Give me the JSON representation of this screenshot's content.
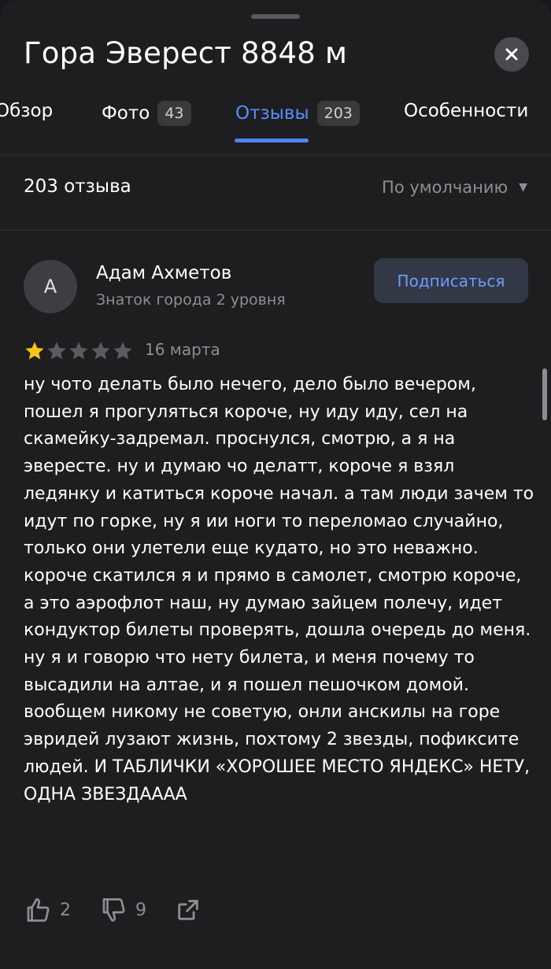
{
  "header": {
    "title": "Гора Эверест 8848 м"
  },
  "tabs": [
    {
      "label": "Обзор",
      "badge": null
    },
    {
      "label": "Фото",
      "badge": "43"
    },
    {
      "label": "Отзывы",
      "badge": "203"
    },
    {
      "label": "Особенности",
      "badge": null
    }
  ],
  "reviews_header": {
    "count": "203 отзыва",
    "sort": "По умолчанию"
  },
  "review": {
    "avatar_letter": "А",
    "author": "Адам Ахметов",
    "level": "Знаток города 2 уровня",
    "subscribe": "Подписаться",
    "rating": 1,
    "rating_max": 5,
    "date": "16 марта",
    "text": "ну чото делать было нечего, дело было вечером, пошел я прогуляться короче, ну иду иду, сел на скамейку-задремал. проснулся, смотрю, а я на эвересте. ну и думаю чо делатт, короче я взял ледянку и катиться короче начал. а там люди зачем то идут по горке, ну я ии ноги то переломао случайно, только они улетели еще кудато, но это неважно. короче скатился я и прямо в самолет, смотрю короче, а это аэрофлот наш, ну думаю зайцем полечу, идет кондуктор билеты проверять, дошла очередь до меня. ну я и говорю что нету билета, и меня почему то высадили на алтае, и я пошел пешочком домой. вообщем никому не советую, онли анскилы на горе эвридей лузают жизнь, похтому 2 звезды, пофиксите людей. И ТАБЛИЧКИ «ХОРОШЕЕ МЕСТО ЯНДЕКС» НЕТУ, ОДНА ЗВЕЗДАААА",
    "likes": "2",
    "dislikes": "9"
  },
  "colors": {
    "accent": "#4d84ff",
    "star_filled": "#f5c518",
    "star_empty": "#5b5b60"
  },
  "icons": [
    "close-icon",
    "star-icon",
    "thumbs-up-icon",
    "thumbs-down-icon",
    "share-icon",
    "chevron-down-icon"
  ]
}
